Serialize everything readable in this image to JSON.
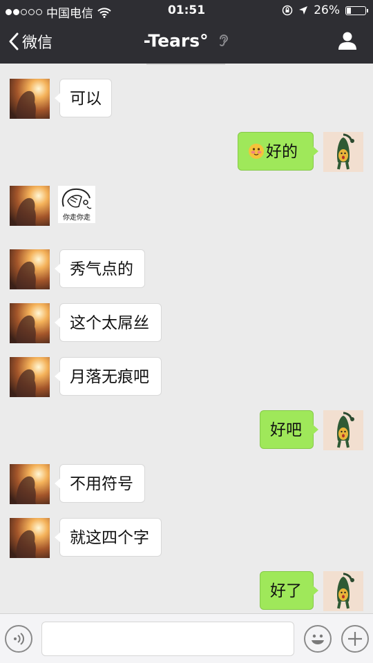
{
  "status_bar": {
    "carrier": "中国电信",
    "time": "01:51",
    "battery": "26%",
    "battery_level": 0.26,
    "signal_bars_filled": 2,
    "signal_bars_total": 5
  },
  "nav": {
    "back_label": "微信",
    "title": "-Tears°",
    "icons": [
      "chevron-left-icon",
      "ear-icon",
      "person-icon"
    ]
  },
  "messages": [
    {
      "side": "in",
      "text": "可以"
    },
    {
      "side": "out",
      "emoji": "shy-face-emoji",
      "text": "好的"
    },
    {
      "side": "in",
      "sticker": true,
      "sticker_caption": "你走你走"
    },
    {
      "side": "in",
      "text": "秀气点的"
    },
    {
      "side": "in",
      "text": "这个太屌丝"
    },
    {
      "side": "in",
      "text": "月落无痕吧"
    },
    {
      "side": "out",
      "text": "好吧"
    },
    {
      "side": "in",
      "text": "不用符号"
    },
    {
      "side": "in",
      "text": "就这四个字"
    },
    {
      "side": "out",
      "text": "好了"
    }
  ],
  "toolbar": {
    "icons": [
      "voice-icon",
      "emoji-icon",
      "plus-icon"
    ]
  },
  "colors": {
    "bar_bg": "#2e2e33",
    "chat_bg": "#ebebeb",
    "outgoing_bubble": "#9fe85a",
    "incoming_bubble": "#ffffff"
  }
}
